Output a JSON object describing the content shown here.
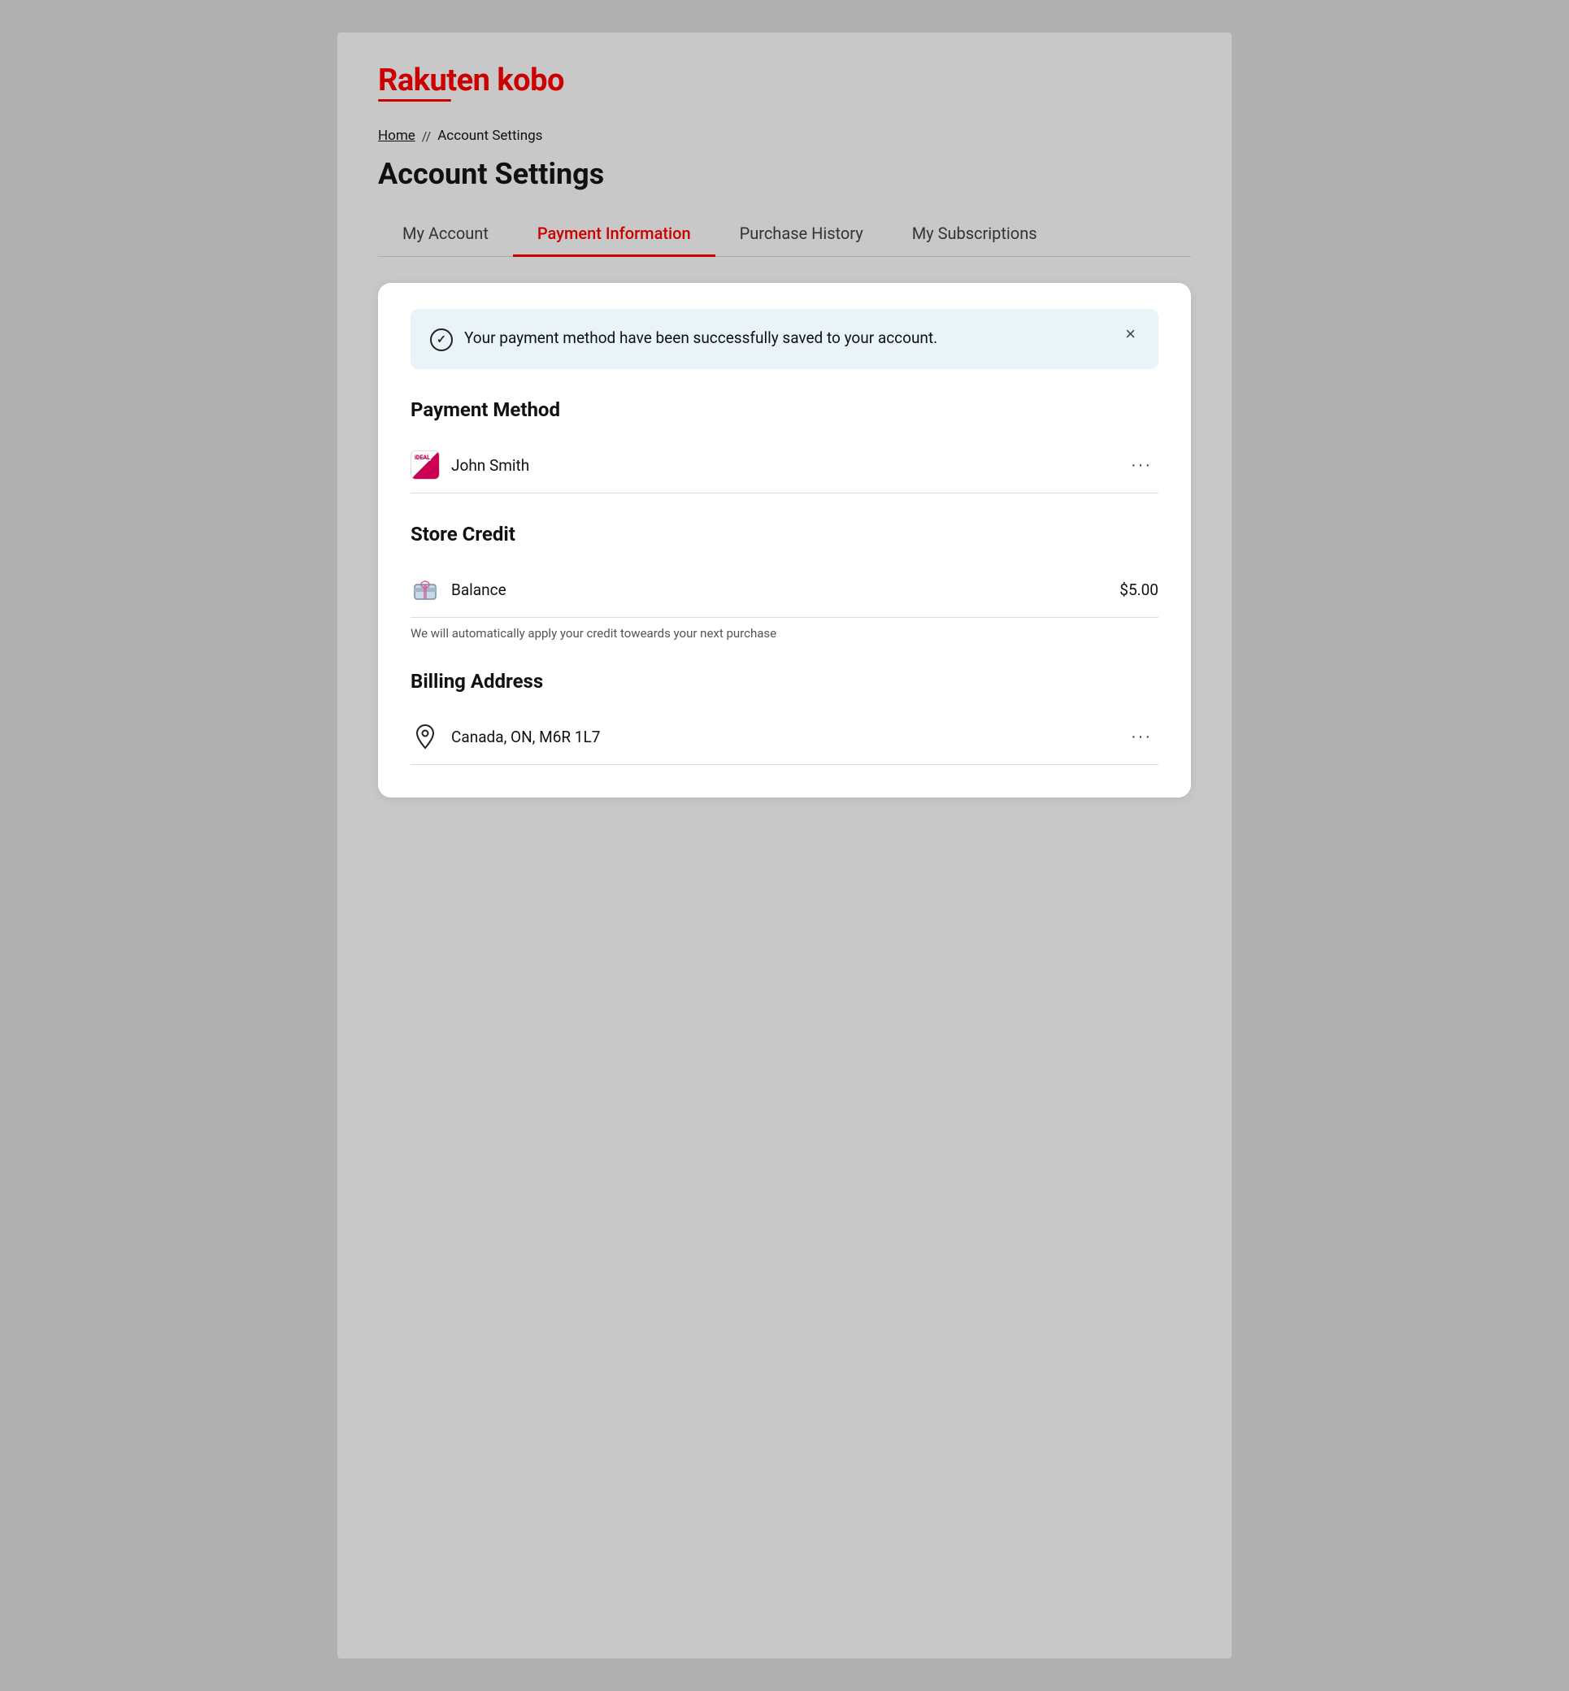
{
  "logo": {
    "text": "Rakuten kobo"
  },
  "breadcrumb": {
    "home": "Home",
    "separator": "//",
    "current": "Account Settings"
  },
  "page_title": "Account Settings",
  "tabs": [
    {
      "id": "my-account",
      "label": "My Account",
      "active": false
    },
    {
      "id": "payment-information",
      "label": "Payment Information",
      "active": true
    },
    {
      "id": "purchase-history",
      "label": "Purchase History",
      "active": false
    },
    {
      "id": "my-subscriptions",
      "label": "My Subscriptions",
      "active": false
    }
  ],
  "notification": {
    "message": "Your payment method have been successfully saved to your account.",
    "close_label": "×"
  },
  "payment_method": {
    "section_title": "Payment Method",
    "name": "John Smith",
    "more_label": "···"
  },
  "store_credit": {
    "section_title": "Store Credit",
    "label": "Balance",
    "value": "$5.00",
    "note": "We will automatically apply your credit toweards your next purchase",
    "more_label": "···"
  },
  "billing_address": {
    "section_title": "Billing Address",
    "address": "Canada, ON, M6R 1L7",
    "more_label": "···"
  }
}
